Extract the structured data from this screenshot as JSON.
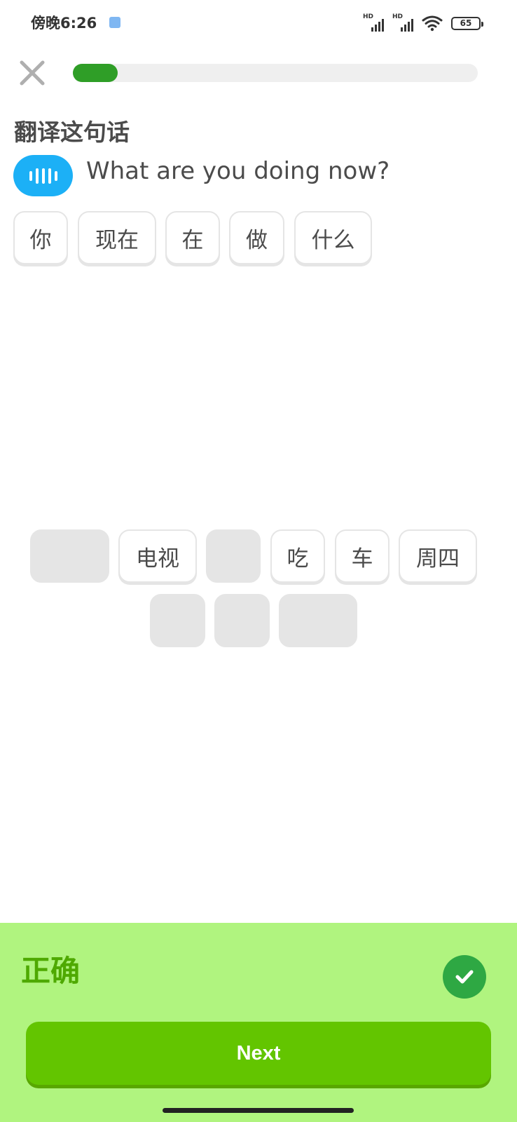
{
  "status_bar": {
    "time": "傍晚6:26",
    "signal_1_label": "HD",
    "signal_2_label": "HD",
    "battery_level": "65"
  },
  "lesson": {
    "progress_fraction": 0.11
  },
  "prompt": {
    "title": "翻译这句话",
    "sentence": "What are you doing now?"
  },
  "answer_tiles": [
    "你",
    "现在",
    "在",
    "做",
    "什么"
  ],
  "word_bank": {
    "row1": [
      {
        "label": "",
        "used": true
      },
      {
        "label": "电视",
        "used": false
      },
      {
        "label": "",
        "used": true
      },
      {
        "label": "吃",
        "used": false
      },
      {
        "label": "车",
        "used": false
      },
      {
        "label": "周四",
        "used": false
      }
    ],
    "row2": [
      {
        "label": "",
        "used": true
      },
      {
        "label": "",
        "used": true
      },
      {
        "label": "",
        "used": true
      }
    ]
  },
  "feedback": {
    "status": "正确",
    "next_label": "Next",
    "colors": {
      "panel": "#b0f47f",
      "accent": "#4ea900",
      "button": "#63c500",
      "badge": "#2ea843"
    }
  },
  "icons": {
    "close": "close-icon",
    "speaker": "audio-wave-icon",
    "check": "checkmark-icon",
    "wifi": "wifi-icon",
    "battery": "battery-icon"
  }
}
